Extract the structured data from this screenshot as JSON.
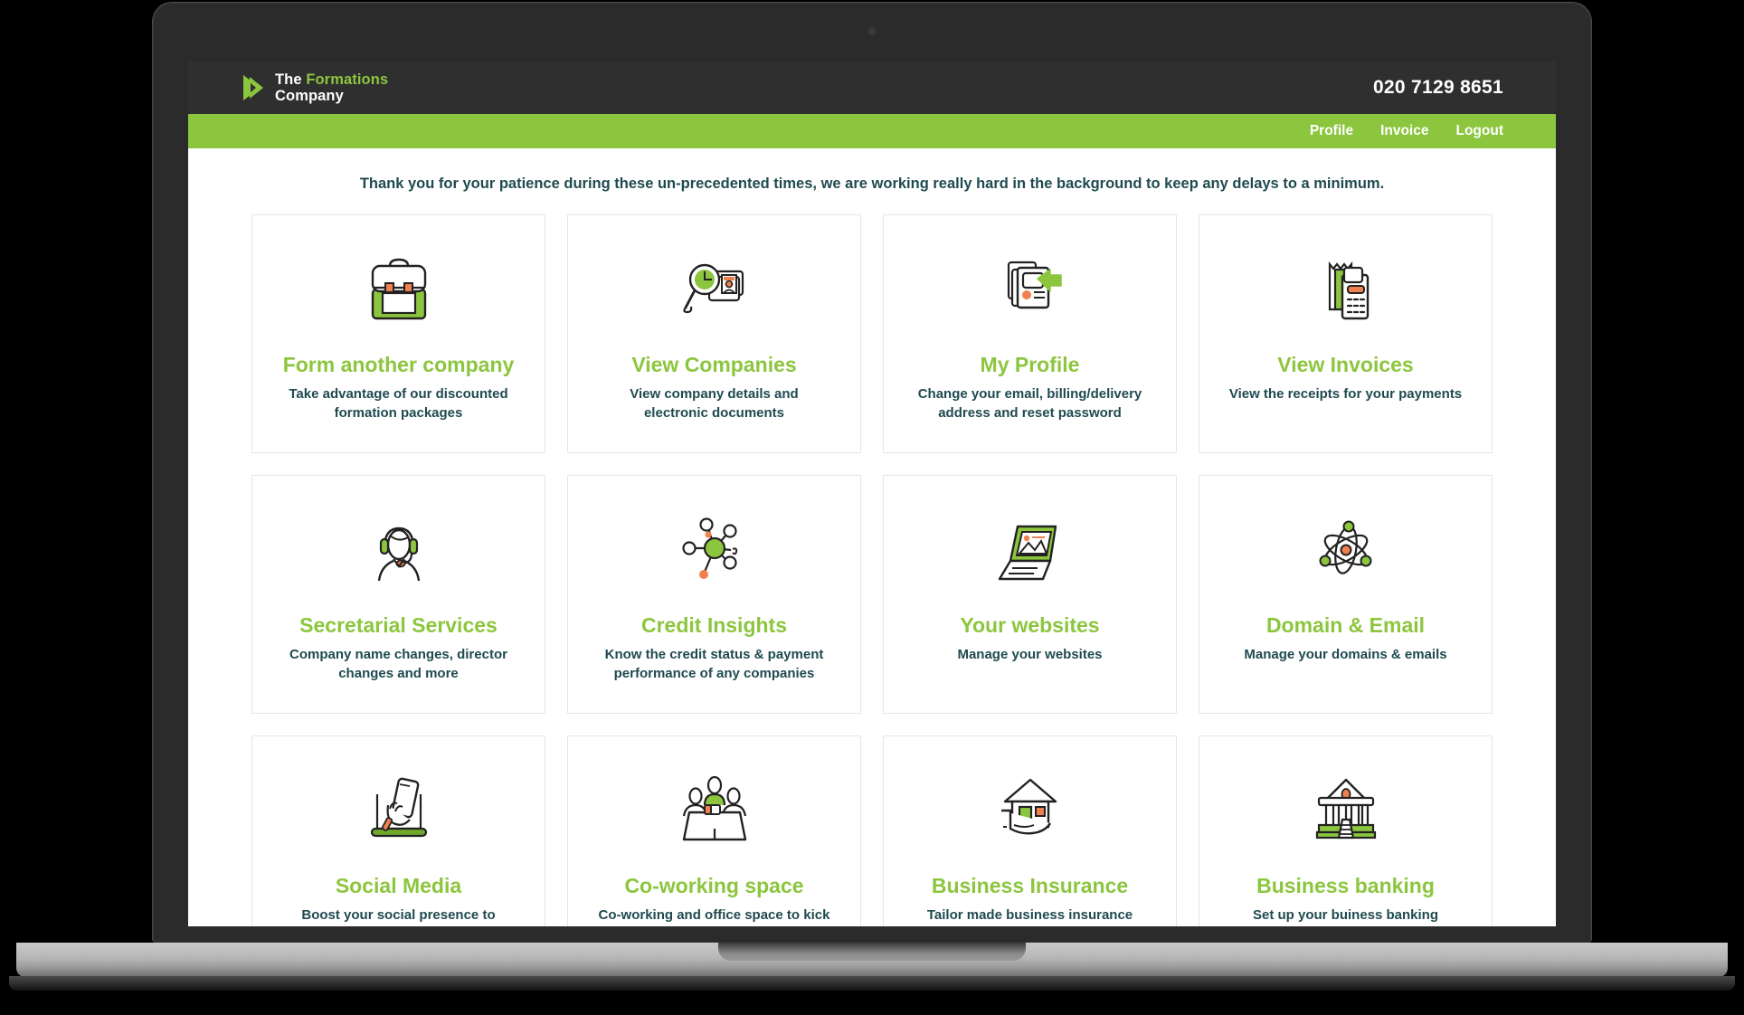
{
  "header": {
    "brand": {
      "logo_icon": "play-arrow-logo",
      "line1_prefix": "The ",
      "line1_accent": "Formations",
      "line2": "Company"
    },
    "phone": "020 7129 8651"
  },
  "nav": {
    "links": [
      {
        "label": "Profile"
      },
      {
        "label": "Invoice"
      },
      {
        "label": "Logout"
      }
    ]
  },
  "notice": {
    "text": "Thank you for your patience during these un-precedented times, we are working really hard in the background to keep any delays to a minimum."
  },
  "colors": {
    "brand_green": "#8CC63E",
    "header_dark": "#2f2f2f",
    "text_navy": "#1f4a50",
    "accent_orange": "#F0804F",
    "card_border": "#e6e6e6"
  },
  "cards": [
    {
      "icon": "briefcase-icon",
      "title": "Form another company",
      "desc": "Take advantage of our discounted formation packages"
    },
    {
      "icon": "magnifier-documents-icon",
      "title": "View Companies",
      "desc": "View company details and electronic documents"
    },
    {
      "icon": "profile-cards-arrow-icon",
      "title": "My Profile",
      "desc": "Change your email, billing/delivery address and reset password"
    },
    {
      "icon": "receipt-calculator-icon",
      "title": "View Invoices",
      "desc": "View the receipts for your payments"
    },
    {
      "icon": "headset-operator-icon",
      "title": "Secretarial Services",
      "desc": "Company name changes, director changes and more"
    },
    {
      "icon": "network-nodes-icon",
      "title": "Credit Insights",
      "desc": "Know the credit status & payment performance of any companies"
    },
    {
      "icon": "laptop-icon",
      "title": "Your websites",
      "desc": "Manage your websites"
    },
    {
      "icon": "atom-icon",
      "title": "Domain & Email",
      "desc": "Manage your domains & emails"
    },
    {
      "icon": "phone-in-hand-icon",
      "title": "Social Media",
      "desc": "Boost your social presence to attract more traffic"
    },
    {
      "icon": "meeting-table-icon",
      "title": "Co-working space",
      "desc": "Co-working and office space to kick start your business journey"
    },
    {
      "icon": "house-in-hand-icon",
      "title": "Business Insurance",
      "desc": "Tailor made business insurance policies"
    },
    {
      "icon": "bank-building-icon",
      "title": "Business banking",
      "desc": "Set up your buiness banking"
    }
  ]
}
